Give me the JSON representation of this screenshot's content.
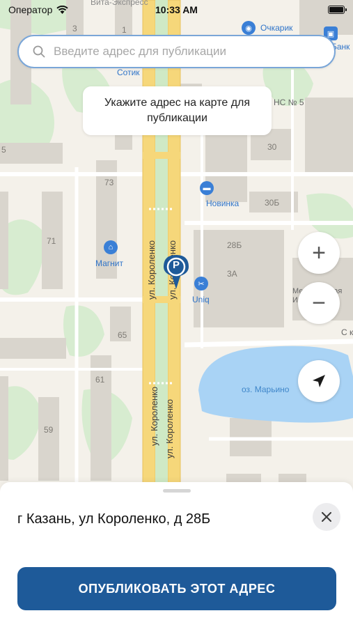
{
  "status_bar": {
    "carrier": "Оператор",
    "time": "10:33 AM"
  },
  "search": {
    "placeholder": "Введите адрес для публикации",
    "value": ""
  },
  "hint": {
    "text": "Укажите адрес на карте для публикации"
  },
  "map": {
    "streets": [
      "ул. Короленко",
      "ул. Короленко",
      "ул. Короленко",
      "ул. Короленко"
    ],
    "place_labels": [
      "Вита-Экспресс",
      "Очкарик",
      "Банк",
      "Сотик",
      "Новинка",
      "Магнит",
      "Uniq",
      "оз. Марьино",
      "Межрайонная ИФНС № 3",
      "НС № 5",
      "С ко"
    ],
    "house_numbers": [
      "3",
      "1",
      "73",
      "71",
      "65",
      "61",
      "59",
      "30",
      "30Б",
      "28Б",
      "3А",
      "5"
    ],
    "pin_letter": "P"
  },
  "controls": {
    "zoom_in": "+",
    "zoom_out": "−"
  },
  "sheet": {
    "address": "г Казань, ул Короленко, д 28Б",
    "publish_label": "ОПУБЛИКОВАТЬ ЭТОТ АДРЕС"
  },
  "colors": {
    "primary": "#1e5a99",
    "search_border": "#7aa6d8",
    "road": "#f6d77a",
    "water": "#a9d3f5",
    "green": "#cfe9c5",
    "building": "#d8d4cc",
    "poi": "#2f74c9"
  }
}
